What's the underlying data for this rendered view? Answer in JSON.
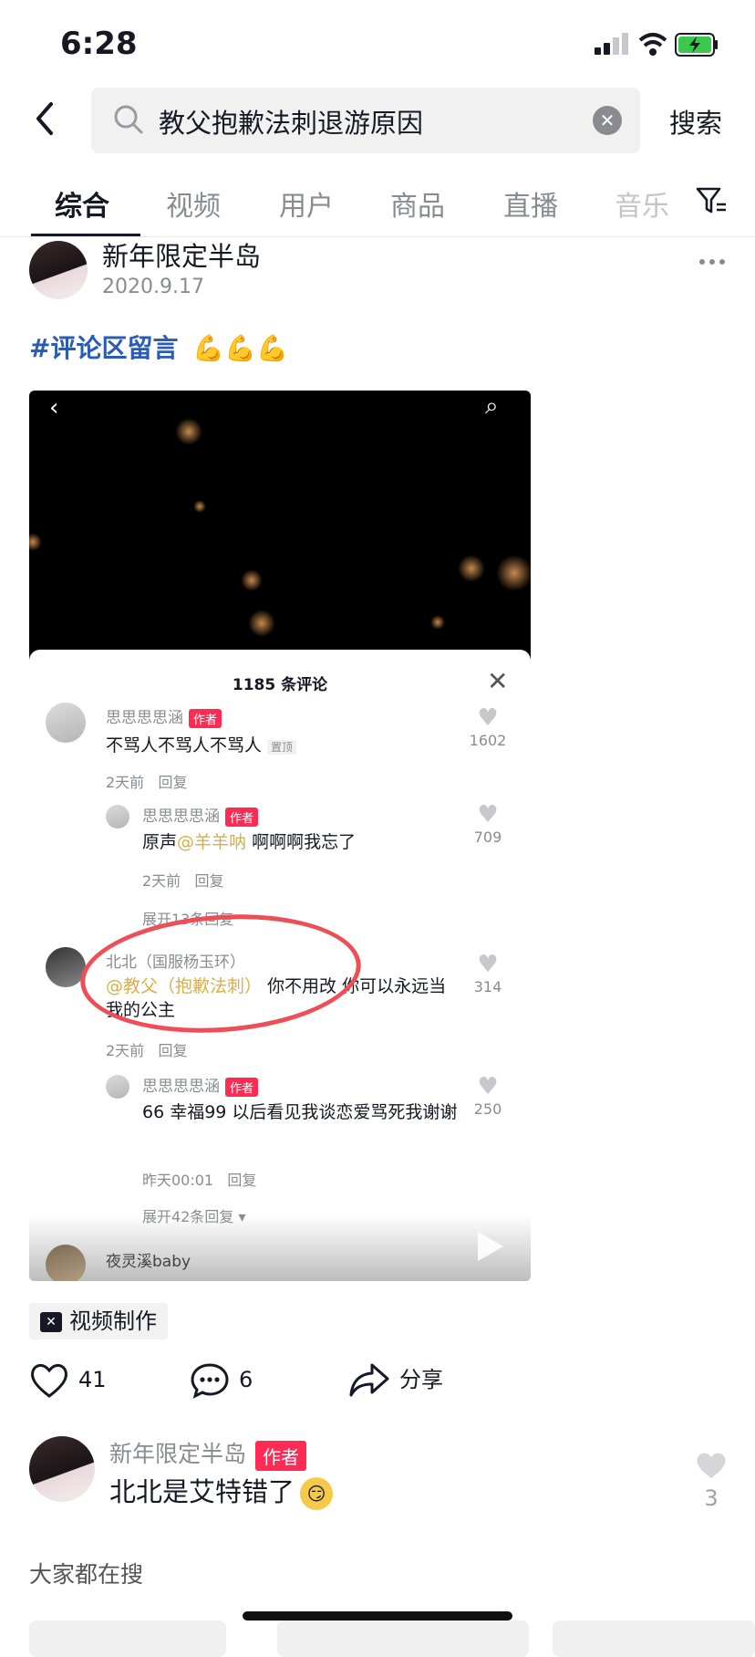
{
  "status_bar": {
    "time": "6:28"
  },
  "search": {
    "query": "教父抱歉法刺退游原因",
    "submit_label": "搜索"
  },
  "tabs": [
    {
      "label": "综合",
      "active": true
    },
    {
      "label": "视频"
    },
    {
      "label": "用户"
    },
    {
      "label": "商品"
    },
    {
      "label": "直播"
    },
    {
      "label": "音乐"
    }
  ],
  "post": {
    "username": "新年限定半岛",
    "date": "2020.9.17",
    "hashtag": "#评论区留言",
    "hashtag_emoji": "💪💪💪"
  },
  "screenshot": {
    "comment_count": "1185 条评论",
    "comments": [
      {
        "name": "思思思思涵",
        "tag": "作者",
        "text": "不骂人不骂人不骂人",
        "pin": "置顶",
        "time": "2天前",
        "reply": "回复",
        "likes": "1602"
      },
      {
        "name": "思思思思涵",
        "tag": "作者",
        "text_prefix": "原声",
        "mention": "@羊羊呐",
        "text": " 啊啊啊我忘了",
        "time": "2天前",
        "reply": "回复",
        "likes": "709"
      },
      {
        "expand": "展开13条回复"
      },
      {
        "name": "北北（国服杨玉环）",
        "mention": "@教父（抱歉法刺）",
        "text": " 你不用改 你可以永远当我的公主",
        "time": "2天前",
        "reply": "回复",
        "likes": "314"
      },
      {
        "name": "思思思思涵",
        "tag": "作者",
        "text": "66 幸福99 以后看见我谈恋爱骂死我谢谢",
        "time": "昨天00:01",
        "reply": "回复",
        "likes": "250"
      },
      {
        "expand": "展开42条回复 ▾"
      },
      {
        "name": "夜灵溪baby"
      }
    ]
  },
  "tool": {
    "label": "视频制作"
  },
  "actions": {
    "likes": "41",
    "comments": "6",
    "share": "分享"
  },
  "comment": {
    "username": "新年限定半岛",
    "tag": "作者",
    "text": "北北是艾特错了",
    "likes": "3"
  },
  "section": {
    "title": "大家都在搜"
  },
  "colors": {
    "accent": "#fe2c55",
    "link": "#2a5bb5",
    "mention": "#d8b04a",
    "annotation": "#ee4f57"
  }
}
